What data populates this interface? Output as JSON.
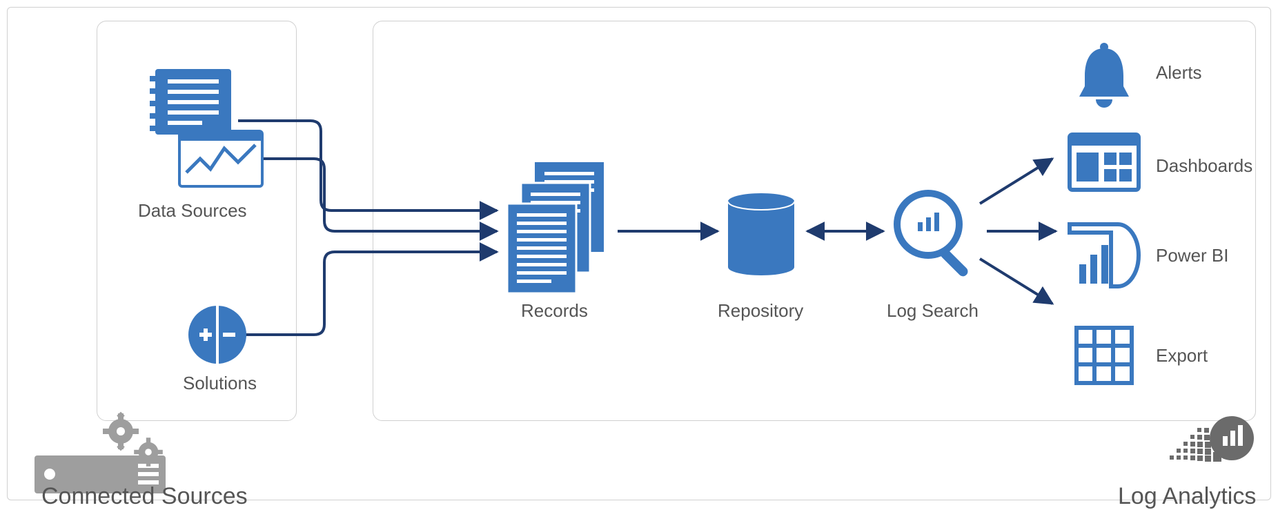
{
  "colors": {
    "blue": "#3a78bf",
    "navy": "#1f3b6e",
    "gray": "#8a8a8a",
    "text": "#555555"
  },
  "labels": {
    "data_sources": "Data Sources",
    "solutions": "Solutions",
    "records": "Records",
    "repository": "Repository",
    "log_search": "Log Search",
    "alerts": "Alerts",
    "dashboards": "Dashboards",
    "power_bi": "Power BI",
    "export": "Export",
    "connected_sources": "Connected Sources",
    "log_analytics": "Log Analytics"
  }
}
